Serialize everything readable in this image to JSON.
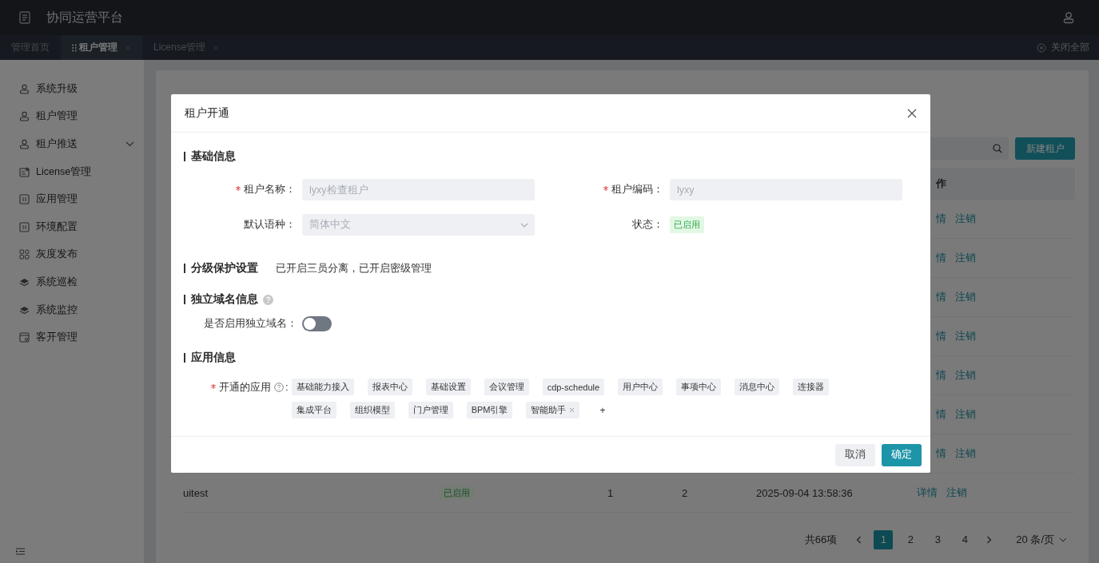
{
  "app": {
    "title": "协同运营平台"
  },
  "tabs": [
    {
      "label": "管理首页",
      "selected": false,
      "closable": false
    },
    {
      "label": "租户管理",
      "selected": true,
      "closable": true
    },
    {
      "label": "License管理",
      "selected": false,
      "closable": true
    }
  ],
  "close_all": "关闭全部",
  "sidebar": {
    "items": [
      {
        "label": "系统升级"
      },
      {
        "label": "租户管理"
      },
      {
        "label": "租户推送",
        "expanded": false
      },
      {
        "label": "License管理"
      },
      {
        "label": "应用管理"
      },
      {
        "label": "环境配置"
      },
      {
        "label": "灰度发布"
      },
      {
        "label": "系统巡检"
      },
      {
        "label": "系统监控"
      },
      {
        "label": "客开管理"
      }
    ]
  },
  "page": {
    "new_button": "新建租户",
    "table": {
      "column_visible": "作",
      "covered_rows": [
        {
          "action_1": "情",
          "action_2": "注销"
        },
        {
          "action_1": "情",
          "action_2": "注销"
        },
        {
          "action_1": "情",
          "action_2": "注销"
        },
        {
          "action_1": "情",
          "action_2": "注销"
        },
        {
          "action_1": "情",
          "action_2": "注销"
        },
        {
          "action_1": "情",
          "action_2": "注销"
        },
        {
          "action_1": "情",
          "action_2": "注销"
        }
      ],
      "rows": [
        {
          "name": "uitest",
          "status": "已启用",
          "column_3": "1",
          "column_4": "2",
          "time": "2025-09-04 13:58:36",
          "action_1": "详情",
          "action_2": "注销"
        }
      ]
    },
    "pagination": {
      "total": "共66项",
      "pages": [
        {
          "label": "1",
          "selected": true
        },
        {
          "label": "2",
          "selected": false
        },
        {
          "label": "3",
          "selected": false
        },
        {
          "label": "4",
          "selected": false
        }
      ],
      "page_size": "20 条/页"
    }
  },
  "dialog": {
    "title": "租户开通",
    "sections": [
      {
        "kind": "form",
        "title": "基础信息",
        "fields": [
          {
            "kind": "input",
            "label": "租户名称：",
            "required": true,
            "placeholder": "lyxy检查租户"
          },
          {
            "kind": "input",
            "label": "租户编码：",
            "required": true,
            "placeholder": "lyxy"
          },
          {
            "kind": "select",
            "label": "默认语种：",
            "required": false,
            "placeholder": "简体中文"
          },
          {
            "kind": "status",
            "label": "状态：",
            "required": false,
            "value": "已启用"
          }
        ]
      },
      {
        "kind": "note",
        "title": "分级保护设置",
        "text": "已开启三员分离，已开启密级管理"
      },
      {
        "kind": "toggle",
        "title": "独立域名信息",
        "help": true,
        "label": "是否启用独立域名：",
        "on": false
      },
      {
        "kind": "apps",
        "title": "应用信息",
        "label": "开通的应用",
        "required": true,
        "apps": [
          {
            "label": "基础能力接入",
            "closable": false
          },
          {
            "label": "报表中心",
            "closable": false
          },
          {
            "label": "基础设置",
            "closable": false
          },
          {
            "label": "会议管理",
            "closable": false
          },
          {
            "label": "cdp-schedule",
            "closable": false
          },
          {
            "label": "用户中心",
            "closable": false
          },
          {
            "label": "事项中心",
            "closable": false
          },
          {
            "label": "消息中心",
            "closable": false
          },
          {
            "label": "连接器",
            "closable": false
          },
          {
            "label": "集成平台",
            "closable": false
          },
          {
            "label": "组织模型",
            "closable": false
          },
          {
            "label": "门户管理",
            "closable": false
          },
          {
            "label": "BPM引擎",
            "closable": false
          },
          {
            "label": "智能助手",
            "closable": true
          }
        ],
        "colon": ":",
        "add": "+"
      }
    ],
    "buttons": [
      {
        "label": "取消",
        "kind": "secondary"
      },
      {
        "label": "确定",
        "kind": "primary"
      }
    ]
  }
}
